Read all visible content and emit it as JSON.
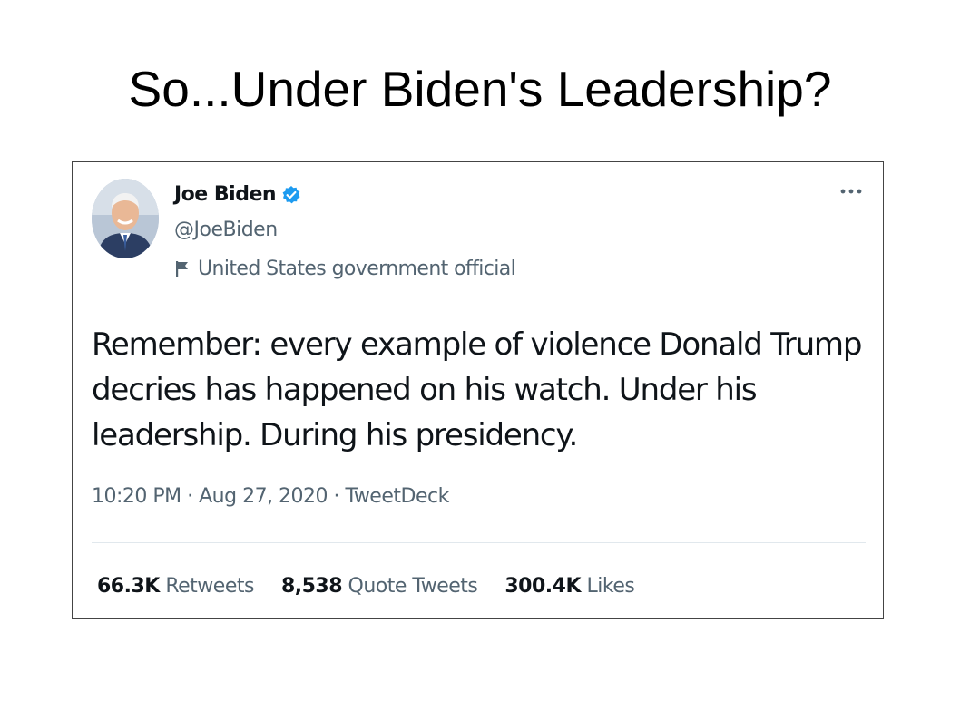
{
  "slide": {
    "title": "So...Under Biden's Leadership?"
  },
  "tweet": {
    "author_name": "Joe Biden",
    "author_handle": "@JoeBiden",
    "government_label": "United States government official",
    "text": "Remember: every example of violence Donald Trump decries has happened on his watch. Under his leadership. During his presidency.",
    "timestamp": "10:20 PM · Aug 27, 2020 · TweetDeck",
    "stats": [
      {
        "count": "66.3K",
        "label": "Retweets"
      },
      {
        "count": "8,538",
        "label": "Quote Tweets"
      },
      {
        "count": "300.4K",
        "label": "Likes"
      }
    ],
    "colors": {
      "verified_blue": "#1d9bf0",
      "secondary_text": "#536471",
      "primary_text": "#0f1419"
    },
    "icons": [
      "verified-badge-icon",
      "government-flag-icon",
      "more-options-icon"
    ]
  }
}
